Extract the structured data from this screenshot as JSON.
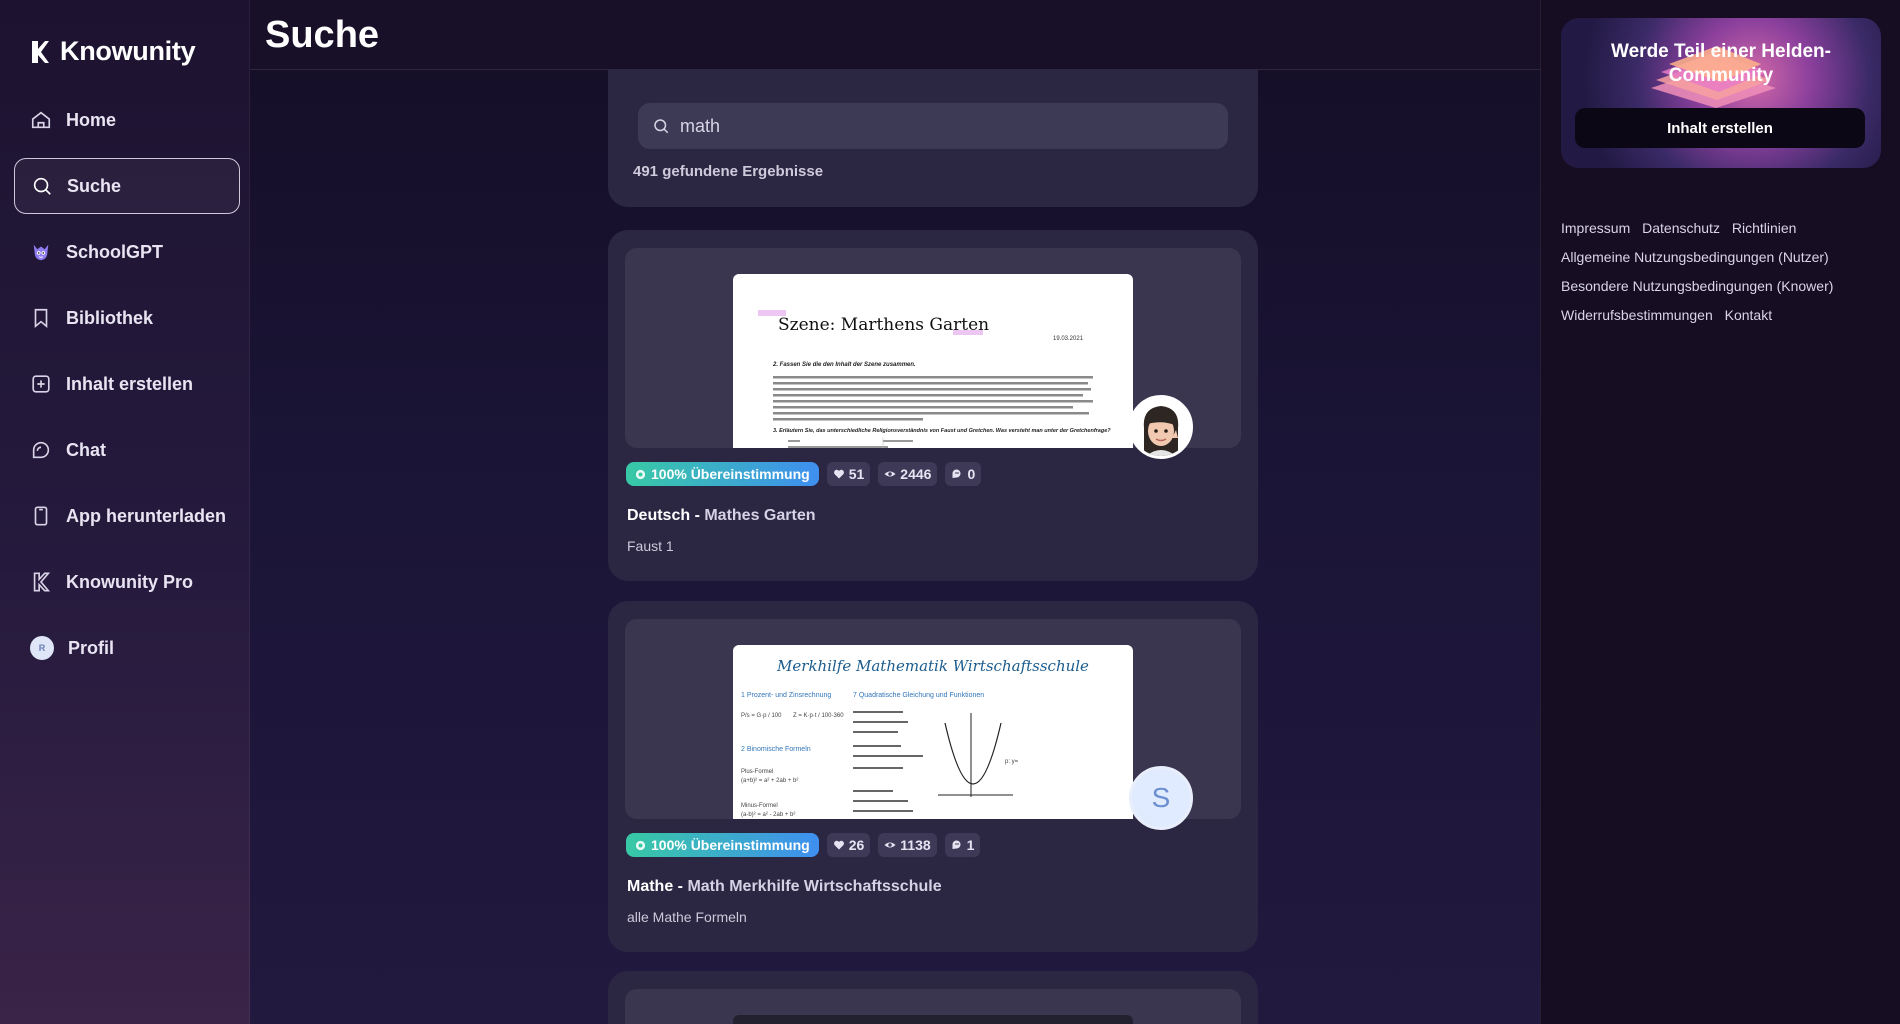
{
  "app": {
    "name": "Knowunity"
  },
  "sidebar": {
    "items": [
      {
        "label": "Home",
        "icon": "home-icon"
      },
      {
        "label": "Suche",
        "icon": "search-icon",
        "active": true
      },
      {
        "label": "SchoolGPT",
        "icon": "schoolgpt-mascot-icon"
      },
      {
        "label": "Bibliothek",
        "icon": "bookmark-icon"
      },
      {
        "label": "Inhalt erstellen",
        "icon": "add-box-icon"
      },
      {
        "label": "Chat",
        "icon": "chat-icon"
      },
      {
        "label": "App herunterladen",
        "icon": "phone-icon"
      },
      {
        "label": "Knowunity Pro",
        "icon": "knowunity-pro-icon"
      },
      {
        "label": "Profil",
        "icon": "avatar",
        "avatar_letter": "R"
      }
    ]
  },
  "header": {
    "title": "Suche"
  },
  "search": {
    "query": "math",
    "results_count": "491 gefundene Ergebnisse"
  },
  "results": [
    {
      "match": "100% Übereinstimmung",
      "likes": "51",
      "views": "2446",
      "comments": "0",
      "subject": "Deutsch",
      "separator": " - ",
      "title": "Mathes Garten",
      "subtitle": "Faust 1",
      "preview": {
        "heading": "Szene: Marthens Garten",
        "date": "19.03.2021",
        "q1": "2. Fassen Sie die den Inhalt der Szene zusammen.",
        "q2": "3. Erläutern Sie, das unterschiedliche Religionsverständnis von Faust und Gretchen. Was versteht man unter der Gretchenfrage?"
      },
      "creator": {
        "type": "memoji"
      }
    },
    {
      "match": "100% Übereinstimmung",
      "likes": "26",
      "views": "1138",
      "comments": "1",
      "subject": "Mathe",
      "separator": " - ",
      "title": "Math Merkhilfe Wirtschaftsschule",
      "subtitle": "alle Mathe Formeln",
      "preview": {
        "heading": "Merkhilfe Mathematik Wirtschaftsschule",
        "left1": "1 Prozent- und Zinsrechnung",
        "right1": "7 Quadratische Gleichung und Funktionen",
        "left2": "2 Binomische Formeln",
        "left3": "Plus-Formel",
        "left4": "Minus-Formel"
      },
      "creator": {
        "type": "letter",
        "letter": "S"
      }
    }
  ],
  "right_panel": {
    "promo_title": "Werde Teil einer Helden-Community",
    "promo_button": "Inhalt erstellen",
    "links": [
      "Impressum",
      "Datenschutz",
      "Richtlinien",
      "Allgemeine Nutzungsbedingungen (Nutzer)",
      "Besondere Nutzungsbedingungen (Knower)",
      "Widerrufsbestimmungen",
      "Kontakt"
    ]
  },
  "colors": {
    "match_gradient_start": "#38c9a5",
    "match_gradient_end": "#3f8ff0",
    "card_bg": "#2b2742",
    "active_border": "#cfc8dc"
  }
}
